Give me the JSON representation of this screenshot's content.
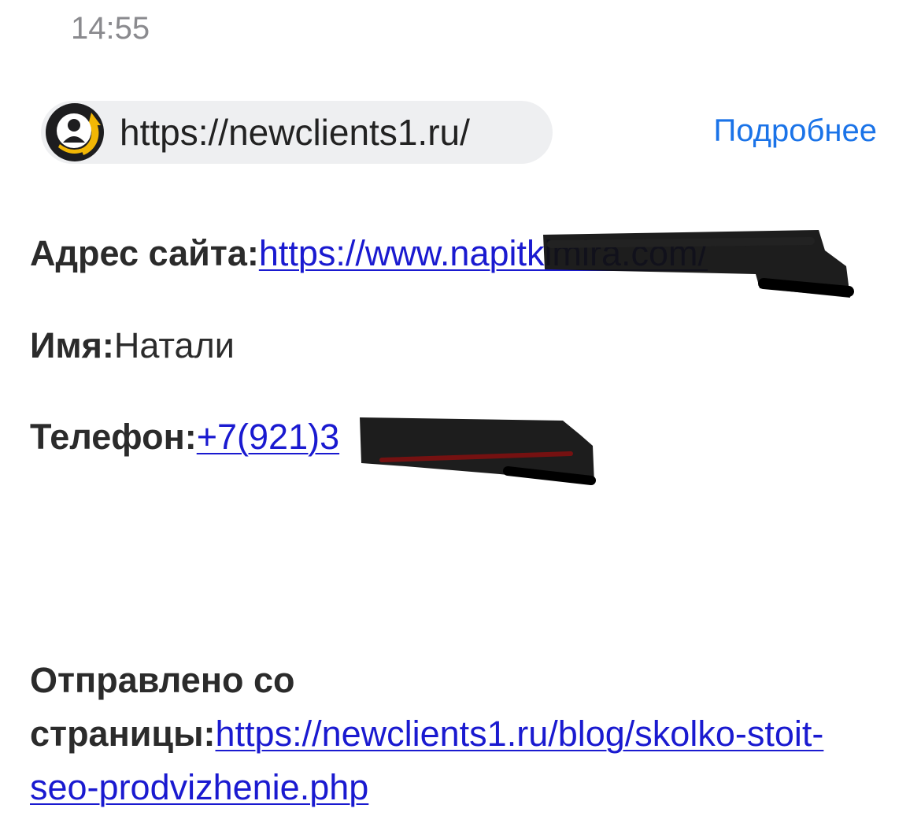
{
  "status_bar": {
    "time": "14:55"
  },
  "sender": {
    "url": "https://newclients1.ru/",
    "more_label": "Подробнее",
    "logo_icon": "newclients-logo-icon",
    "colors": {
      "chip_bg": "#eeeff1",
      "more_link": "#1a73e8",
      "logo_dark": "#1d1d1f",
      "logo_accent": "#f2b705"
    }
  },
  "message": {
    "site": {
      "label": "Адрес сайта:",
      "value": "https://www.napitkimira.com/"
    },
    "name": {
      "label": "Имя:",
      "value": "Натали"
    },
    "phone": {
      "label": "Телефон:",
      "value": "+7(921)3"
    },
    "source": {
      "label_line1": "Отправлено со",
      "label_line2": "страницы:",
      "value": "https://newclients1.ru/blog/skolko-stoit-seo-prodvizhenie.php"
    }
  },
  "colors": {
    "link": "#1a1ad0",
    "text": "#2b2b2b",
    "redaction": "#111111"
  }
}
